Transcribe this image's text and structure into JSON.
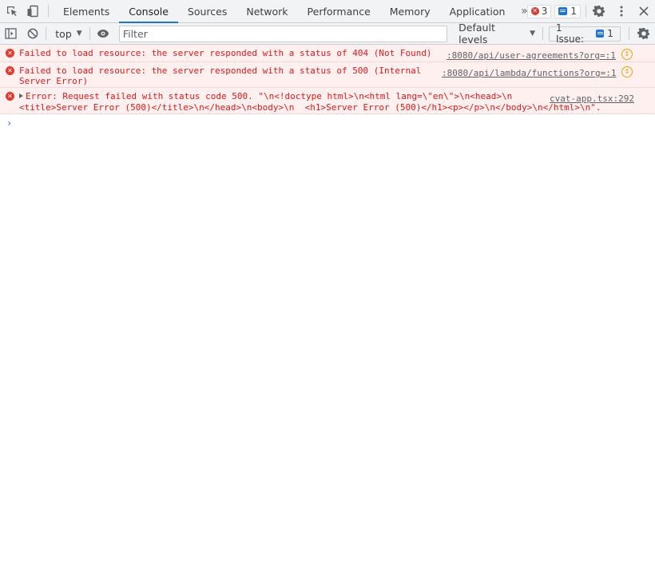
{
  "tabbar": {
    "tabs": [
      {
        "label": "Elements"
      },
      {
        "label": "Console"
      },
      {
        "label": "Sources"
      },
      {
        "label": "Network"
      },
      {
        "label": "Performance"
      },
      {
        "label": "Memory"
      },
      {
        "label": "Application"
      }
    ],
    "active_tab": "Console",
    "more_label": "»",
    "error_count": "3",
    "message_count": "1"
  },
  "console_toolbar": {
    "context": "top",
    "filter_placeholder": "Filter",
    "levels": "Default levels",
    "issues_label": "1 Issue:",
    "issues_count": "1"
  },
  "messages": [
    {
      "lines": [
        "Failed to load resource: the server responded with a status of 404 (Not Found)"
      ],
      "source": ":8080/api/user-agreements?org=:1"
    },
    {
      "lines": [
        "Failed to load resource: the server responded with a status of 500 (Internal",
        "Server Error)"
      ],
      "source": ":8080/api/lambda/functions?org=:1"
    },
    {
      "lines": [
        "Error: Request failed with status code 500. \"\\n<!doctype html>\\n<html lang=\\\"en\\\">\\n<head>\\n",
        "<title>Server Error (500)</title>\\n</head>\\n<body>\\n  <h1>Server Error (500)</h1><p></p>\\n</body>\\n</html>\\n\"."
      ],
      "source": "cvat-app.tsx:292"
    }
  ],
  "prompt_symbol": "›"
}
